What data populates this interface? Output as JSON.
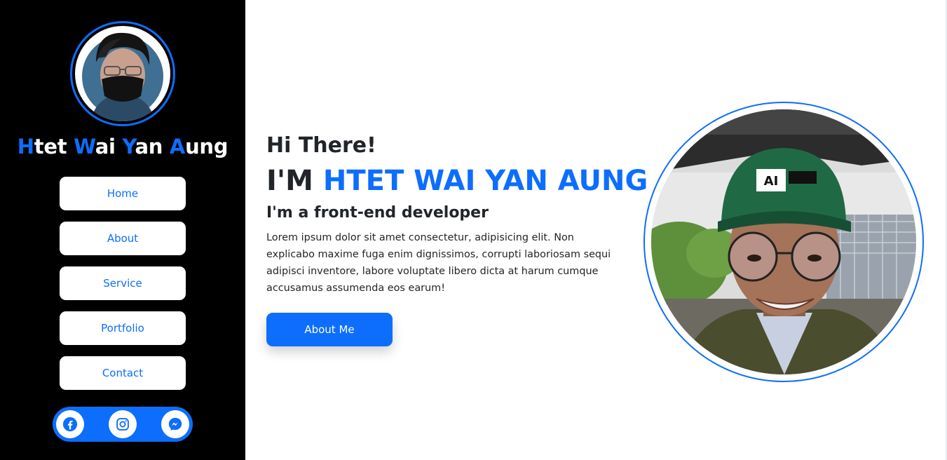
{
  "sidebar": {
    "brand": {
      "parts": [
        {
          "initial": "H",
          "rest": "tet "
        },
        {
          "initial": "W",
          "rest": "ai "
        },
        {
          "initial": "Y",
          "rest": "an "
        },
        {
          "initial": "A",
          "rest": "ung"
        }
      ]
    },
    "nav": [
      {
        "label": "Home"
      },
      {
        "label": "About"
      },
      {
        "label": "Service"
      },
      {
        "label": "Portfolio"
      },
      {
        "label": "Contact"
      }
    ],
    "social": [
      "facebook-icon",
      "instagram-icon",
      "messenger-icon"
    ]
  },
  "hero": {
    "greeting": "Hi There!",
    "title_prefix": "I'M",
    "title_name": "HTET WAI YAN AUNG",
    "role": "I'm a front-end developer",
    "description": "Lorem ipsum dolor sit amet consectetur, adipisicing elit. Non explicabo maxime fuga enim dignissimos, corrupti laboriosam sequi adipisci inventore, labore voluptate libero dicta at harum cumque accusamus assumenda eos earum!",
    "cta_label": "About Me"
  },
  "colors": {
    "accent": "#0d6efd",
    "sidebar_bg": "#000000",
    "text": "#212529"
  }
}
